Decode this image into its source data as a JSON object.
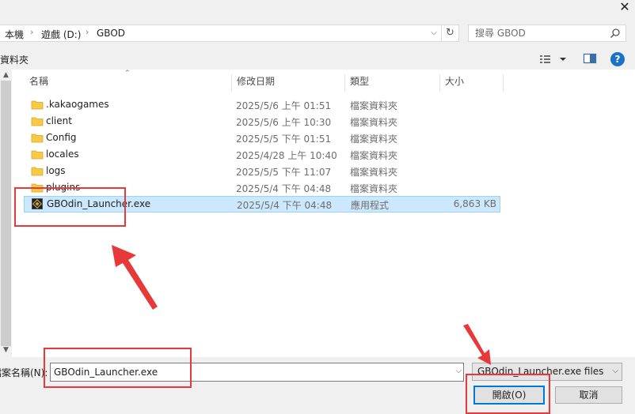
{
  "window": {
    "close_glyph": "✕"
  },
  "address_bar": {
    "crumbs": [
      "本機",
      "遊戲 (D:)",
      "GBOD"
    ],
    "separator": "›",
    "dropdown_glyph": "⌵",
    "refresh_glyph": "↻"
  },
  "search": {
    "placeholder": "搜尋 GBOD",
    "icon": "search-icon"
  },
  "toolbar": {
    "new_folder_label": "資料夾",
    "view_icon": "details-view-icon",
    "pane_icon": "preview-pane-icon",
    "help_label": "?"
  },
  "columns": [
    "名稱",
    "修改日期",
    "類型",
    "大小"
  ],
  "files": [
    {
      "name": ".kakaogames",
      "date": "2025/5/6 上午 01:51",
      "type": "檔案資料夾",
      "size": "",
      "icon": "folder-icon",
      "selected": false
    },
    {
      "name": "client",
      "date": "2025/5/6 上午 10:30",
      "type": "檔案資料夾",
      "size": "",
      "icon": "folder-icon",
      "selected": false
    },
    {
      "name": "Config",
      "date": "2025/5/5 下午 01:51",
      "type": "檔案資料夾",
      "size": "",
      "icon": "folder-icon",
      "selected": false
    },
    {
      "name": "locales",
      "date": "2025/4/28 上午 10:40",
      "type": "檔案資料夾",
      "size": "",
      "icon": "folder-icon",
      "selected": false
    },
    {
      "name": "logs",
      "date": "2025/5/5 下午 11:07",
      "type": "檔案資料夾",
      "size": "",
      "icon": "folder-icon",
      "selected": false
    },
    {
      "name": "plugins",
      "date": "2025/5/4 下午 04:48",
      "type": "檔案資料夾",
      "size": "",
      "icon": "folder-icon",
      "selected": false
    },
    {
      "name": "GBOdin_Launcher.exe",
      "date": "2025/5/4 下午 04:48",
      "type": "應用程式",
      "size": "6,863 KB",
      "icon": "app-exe-icon",
      "selected": true
    }
  ],
  "footer": {
    "filename_label": "檔案名稱(N):",
    "filename_value": "GBOdin_Launcher.exe",
    "filetype_value": "GBOdin_Launcher.exe files (*.exe)",
    "open_label": "開啟(O)",
    "cancel_label": "取消"
  },
  "colors": {
    "selection_fill": "#cce8ff",
    "selection_border": "#99d1ff",
    "annotation_red": "#e8393a",
    "folder_yellow": "#f7c948",
    "accent_blue": "#0078d7"
  }
}
